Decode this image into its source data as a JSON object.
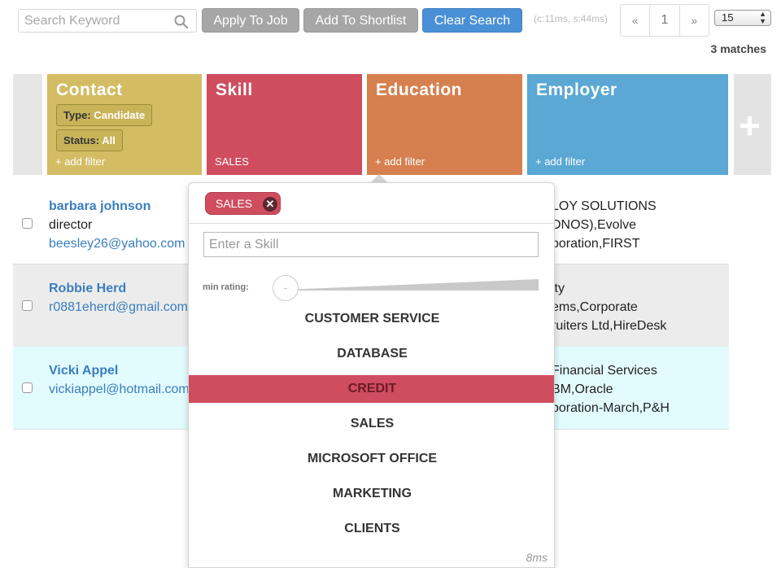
{
  "toolbar": {
    "search_placeholder": "Search Keyword",
    "apply_label": "Apply To Job",
    "shortlist_label": "Add To Shortlist",
    "clear_label": "Clear Search",
    "timing": "(c:11ms, s:44ms)",
    "pager_prev": "«",
    "pager_page": "1",
    "pager_next": "»",
    "per_page": "15",
    "matches": "3 matches"
  },
  "filters": {
    "contact": {
      "title": "Contact",
      "type_label": "Type:",
      "type_value": "Candidate",
      "status_label": "Status:",
      "status_value": "All",
      "add": "+ add filter",
      "color": "#d3bc63"
    },
    "skill": {
      "title": "Skill",
      "value": "SALES",
      "color": "#cf4d5f"
    },
    "education": {
      "title": "Education",
      "add": "+ add filter",
      "color": "#d6804f"
    },
    "employer": {
      "title": "Employer",
      "add": "+ add filter",
      "color": "#5aa8d3"
    },
    "plus": "+"
  },
  "results": [
    {
      "name": "barbara johnson",
      "line1": "director",
      "line2": "beesley26@yahoo.com",
      "emp1": "LOY SOLUTIONS",
      "emp2": "DNOS),Evolve",
      "emp3": "poration,FIRST"
    },
    {
      "name": "Robbie Herd",
      "line1": "r0881eherd@gmail.com",
      "emp1": "ity",
      "emp2": "ems,Corporate",
      "emp3": "ruiters Ltd,HireDesk"
    },
    {
      "name": "Vicki Appel",
      "line1": "vickiappel@hotmail.com",
      "emp1": "Financial Services",
      "emp2": "BM,Oracle",
      "emp3": "poration-March,P&H"
    }
  ],
  "skill_popover": {
    "selected_tag": "SALES",
    "input_placeholder": "Enter a Skill",
    "min_rating_label": "min rating:",
    "knob": "-",
    "suggestions": [
      "CUSTOMER SERVICE",
      "DATABASE",
      "CREDIT",
      "SALES",
      "MICROSOFT OFFICE",
      "MARKETING",
      "CLIENTS"
    ],
    "active_index": 2,
    "time": "8ms"
  }
}
